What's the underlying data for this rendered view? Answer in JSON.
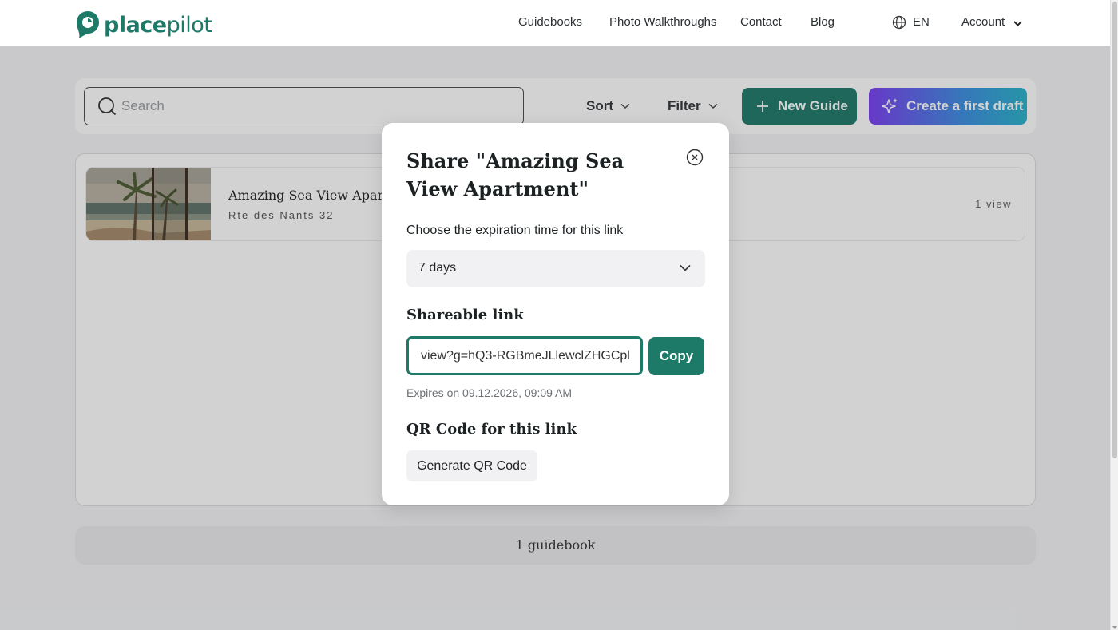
{
  "app": {
    "brand": {
      "name_bold": "place",
      "name_light": "pilot",
      "color": "#1e7a68"
    }
  },
  "header": {
    "nav": [
      "Guidebooks",
      "Photo Walkthroughs",
      "Contact",
      "Blog"
    ],
    "language": "EN",
    "account_label": "Account"
  },
  "toolbar": {
    "search_placeholder": "Search",
    "sort_label": "Sort",
    "filter_label": "Filter",
    "new_guide_label": "New Guide",
    "draft_label": "Create a first draft"
  },
  "guides": [
    {
      "title": "Amazing Sea View Apartm",
      "address": "Rte des Nants 32",
      "views": "1 view"
    }
  ],
  "footer": {
    "count_label": "1 guidebook"
  },
  "modal": {
    "title": "Share \"Amazing Sea View Apartment\"",
    "expiration_label": "Choose the expiration time for this link",
    "expiration_value": "7 days",
    "shareable_heading": "Shareable link",
    "link_value": "view?g=hQ3-RGBmeJLlewclZHGCpl",
    "copy_label": "Copy",
    "expires_text": "Expires on 09.12.2026, 09:09 AM",
    "qr_heading": "QR Code for this link",
    "qr_button_label": "Generate QR Code"
  },
  "colors": {
    "accent": "#1e7a68",
    "draft_gradient_start": "#7b3ff2",
    "draft_gradient_end": "#29b3c9"
  }
}
